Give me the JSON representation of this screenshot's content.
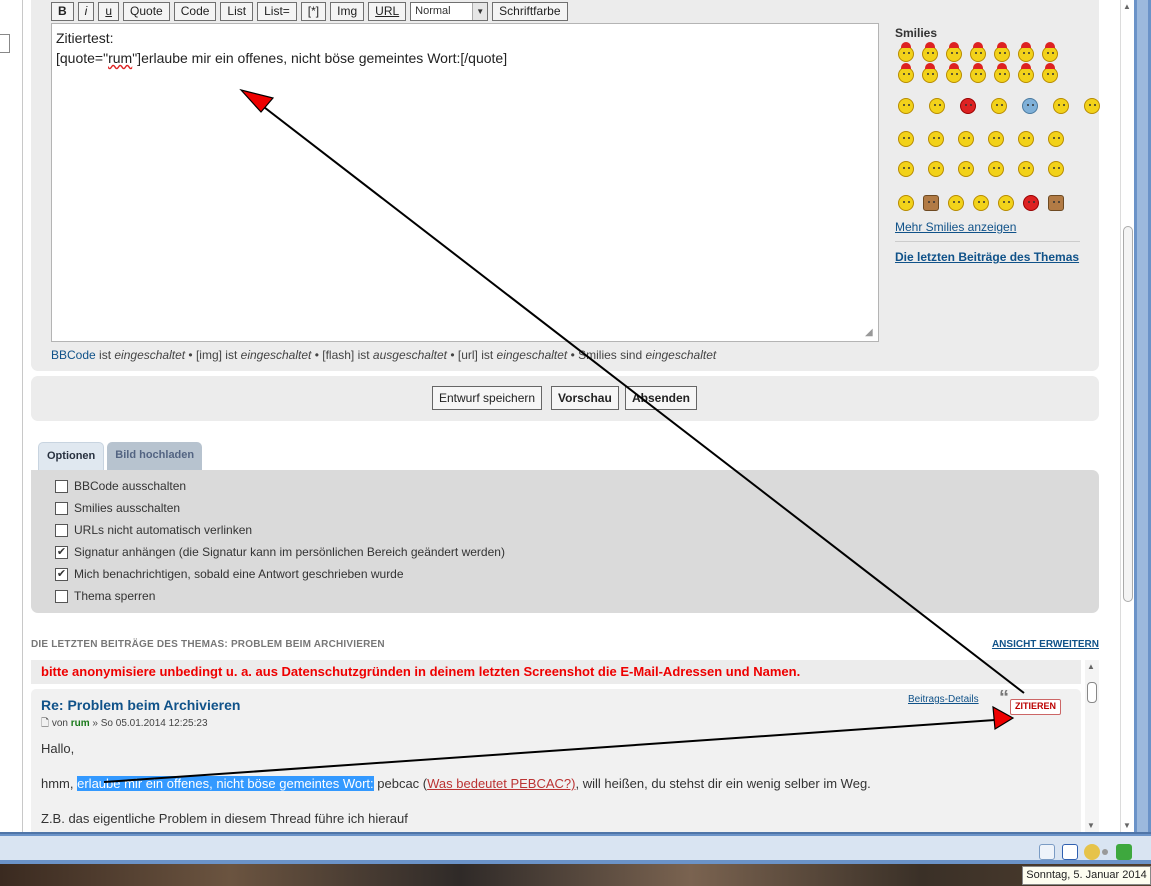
{
  "toolbar": {
    "bold": "B",
    "italic": "i",
    "underline": "u",
    "quote": "Quote",
    "code": "Code",
    "list": "List",
    "list_ordered": "List=",
    "list_item": "[*]",
    "img": "Img",
    "url": "URL",
    "size_select": "Normal",
    "font_color": "Schriftfarbe"
  },
  "editor": {
    "line1": "Zitiertest:",
    "line2_pre": "[quote=\"",
    "line2_user": "rum",
    "line2_post": "\"]erlaube mir ein offenes, nicht böse gemeintes Wort:[/quote]"
  },
  "bbcode_info": {
    "bbcode_link": "BBCode",
    "t1": " ist ",
    "on1": "eingeschaltet",
    "t2": " • [img] ist ",
    "on2": "eingeschaltet",
    "t3": " • [flash] ist ",
    "off3": "ausgeschaltet",
    "t4": " • [url] ist ",
    "on4": "eingeschaltet",
    "t5": " • Smilies sind ",
    "on5": "eingeschaltet"
  },
  "smilies": {
    "title": "Smilies",
    "more_link": "Mehr Smilies anzeigen",
    "last_posts_link": "Die letzten Beiträge des Themas"
  },
  "buttons": {
    "save_draft": "Entwurf speichern",
    "preview": "Vorschau",
    "submit": "Absenden"
  },
  "tabs": {
    "options": "Optionen",
    "upload": "Bild hochladen"
  },
  "options": [
    {
      "label": "BBCode ausschalten",
      "checked": false
    },
    {
      "label": "Smilies ausschalten",
      "checked": false
    },
    {
      "label": "URLs nicht automatisch verlinken",
      "checked": false
    },
    {
      "label": "Signatur anhängen (die Signatur kann im persönlichen Bereich geändert werden)",
      "checked": true
    },
    {
      "label": "Mich benachrichtigen, sobald eine Antwort geschrieben wurde",
      "checked": true
    },
    {
      "label": "Thema sperren",
      "checked": false
    }
  ],
  "recent": {
    "heading": "DIE LETZTEN BEITRÄGE DES THEMAS: PROBLEM BEIM ARCHIVIEREN",
    "expand": "ANSICHT ERWEITERN",
    "anon_notice": "bitte anonymisiere unbedingt u. a. aus Datenschutzgründen in deinem letzten Screenshot die E-Mail-Adressen und Namen.",
    "post": {
      "title": "Re: Problem beim Archivieren",
      "meta_von": "von ",
      "author": "rum",
      "meta_date": " » So 05.01.2014 12:25:23",
      "details": "Beitrags-Details",
      "quote_btn": "ZITIEREN",
      "p1": "Hallo,",
      "p2_pre": "hmm, ",
      "p2_sel": "erlaube mir ein offenes, nicht böse gemeintes Wort:",
      "p2_mid": " pebcac (",
      "p2_link": "Was bedeutet PEBCAC?)",
      "p2_post": ", will heißen, du stehst dir ein wenig selber im Weg.",
      "p3": "Z.B. das eigentliche Problem in diesem Thread führe ich hierauf"
    }
  },
  "taskbar": {
    "clock": "Sonntag, 5. Januar 2014"
  },
  "colors": {
    "link": "#105289",
    "warning": "#e00000",
    "selection": "#3399ff",
    "panel": "#ececec"
  }
}
